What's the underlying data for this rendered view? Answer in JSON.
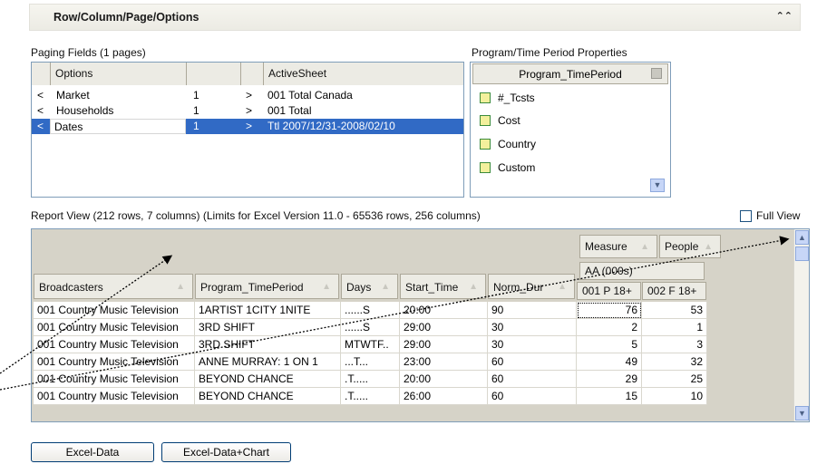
{
  "header": {
    "title": "Row/Column/Page/Options",
    "collapse_icon": "double-chevron-up-icon"
  },
  "paging": {
    "label": "Paging Fields  (1 pages)",
    "columns": [
      "Options",
      "",
      "",
      "ActiveSheet"
    ],
    "rows": [
      {
        "lt": "<",
        "name": "Market",
        "count": "1",
        "gt": ">",
        "value": "001 Total Canada"
      },
      {
        "lt": "<",
        "name": "Households",
        "count": "1",
        "gt": ">",
        "value": "001 Total"
      },
      {
        "lt": "<",
        "name": "Dates",
        "count": "1",
        "gt": ">",
        "value": "Ttl 2007/12/31-2008/02/10"
      }
    ]
  },
  "properties": {
    "label": "Program/Time Period Properties",
    "column": "Program_TimePeriod",
    "items": [
      "#_Tcsts",
      "Cost",
      "Country",
      "Custom"
    ]
  },
  "report": {
    "label": "Report View  (212 rows, 7 columns) (Limits for Excel Version 11.0 - 65536 rows, 256 columns)",
    "full_view_label": "Full View",
    "top_headers": [
      "Measure",
      "People"
    ],
    "measure_label": "AA (000s)",
    "columns": [
      "Broadcasters",
      "Program_TimePeriod",
      "Days",
      "Start_Time",
      "Norm_Dur",
      "001 P 18+",
      "002 F 18+"
    ],
    "rows": [
      [
        "001 Country Music Television",
        "1ARTIST 1CITY 1NITE",
        "......S",
        "20:00",
        "90",
        "76",
        "53"
      ],
      [
        "001 Country Music Television",
        "3RD SHIFT",
        "......S",
        "29:00",
        "30",
        "2",
        "1"
      ],
      [
        "001 Country Music Television",
        "3RD SHIFT",
        "MTWTF..",
        "29:00",
        "30",
        "5",
        "3"
      ],
      [
        "001 Country Music Television",
        "ANNE MURRAY: 1 ON 1",
        "...T...",
        "23:00",
        "60",
        "49",
        "32"
      ],
      [
        "001 Country Music Television",
        "BEYOND CHANCE",
        ".T.....",
        "20:00",
        "60",
        "29",
        "25"
      ],
      [
        "001 Country Music Television",
        "BEYOND CHANCE",
        ".T.....",
        "26:00",
        "60",
        "15",
        "10"
      ]
    ]
  },
  "buttons": {
    "excel_data": "Excel-Data",
    "excel_data_chart": "Excel-Data+Chart"
  },
  "colors": {
    "selection": "#316ac5",
    "border": "#7f9db9",
    "header_bg": "#ecebe4",
    "grid_bg": "#d6d3c8"
  }
}
